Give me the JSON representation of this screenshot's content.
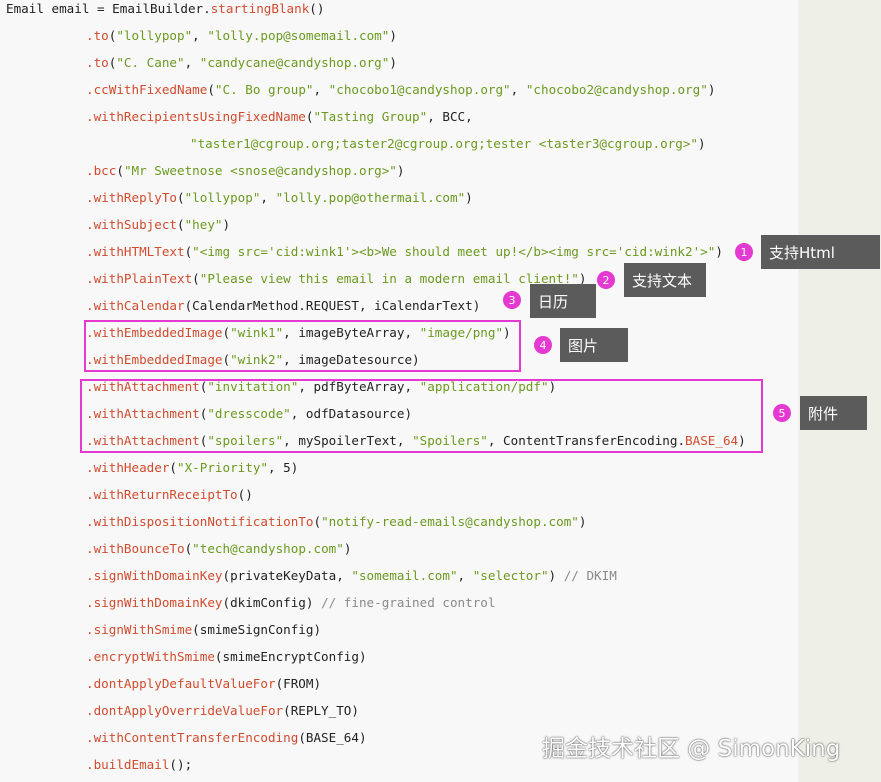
{
  "code": {
    "lines": [
      {
        "tokens": [
          [
            "plain",
            "Email email = EmailBuilder."
          ],
          [
            "fn",
            "startingBlank"
          ],
          [
            "plain",
            "()"
          ]
        ]
      },
      {
        "tokens": [
          [
            "fn",
            ".to"
          ],
          [
            "plain",
            "("
          ],
          [
            "str",
            "\"lollypop\""
          ],
          [
            "plain",
            ", "
          ],
          [
            "str",
            "\"lolly.pop@somemail.com\""
          ],
          [
            "plain",
            ")"
          ]
        ]
      },
      {
        "tokens": [
          [
            "fn",
            ".to"
          ],
          [
            "plain",
            "("
          ],
          [
            "str",
            "\"C. Cane\""
          ],
          [
            "plain",
            ", "
          ],
          [
            "str",
            "\"candycane@candyshop.org\""
          ],
          [
            "plain",
            ")"
          ]
        ]
      },
      {
        "tokens": [
          [
            "fn",
            ".ccWithFixedName"
          ],
          [
            "plain",
            "("
          ],
          [
            "str",
            "\"C. Bo group\""
          ],
          [
            "plain",
            ", "
          ],
          [
            "str",
            "\"chocobo1@candyshop.org\""
          ],
          [
            "plain",
            ", "
          ],
          [
            "str",
            "\"chocobo2@candyshop.org\""
          ],
          [
            "plain",
            ")"
          ]
        ]
      },
      {
        "tokens": [
          [
            "fn",
            ".withRecipientsUsingFixedName"
          ],
          [
            "plain",
            "("
          ],
          [
            "str",
            "\"Tasting Group\""
          ],
          [
            "plain",
            ", BCC,"
          ]
        ]
      },
      {
        "tokens": [
          [
            "str",
            "\"taster1@cgroup.org;taster2@cgroup.org;tester <taster3@cgroup.org>\""
          ],
          [
            "plain",
            ")"
          ]
        ]
      },
      {
        "tokens": [
          [
            "fn",
            ".bcc"
          ],
          [
            "plain",
            "("
          ],
          [
            "str",
            "\"Mr Sweetnose <snose@candyshop.org>\""
          ],
          [
            "plain",
            ")"
          ]
        ]
      },
      {
        "tokens": [
          [
            "fn",
            ".withReplyTo"
          ],
          [
            "plain",
            "("
          ],
          [
            "str",
            "\"lollypop\""
          ],
          [
            "plain",
            ", "
          ],
          [
            "str",
            "\"lolly.pop@othermail.com\""
          ],
          [
            "plain",
            ")"
          ]
        ]
      },
      {
        "tokens": [
          [
            "fn",
            ".withSubject"
          ],
          [
            "plain",
            "("
          ],
          [
            "str",
            "\"hey\""
          ],
          [
            "plain",
            ")"
          ]
        ]
      },
      {
        "tokens": [
          [
            "fn",
            ".withHTMLText"
          ],
          [
            "plain",
            "("
          ],
          [
            "str",
            "\"<img src='cid:wink1'><b>We should meet up!</b><img src='cid:wink2'>\""
          ],
          [
            "plain",
            ")"
          ]
        ]
      },
      {
        "tokens": [
          [
            "fn",
            ".withPlainText"
          ],
          [
            "plain",
            "("
          ],
          [
            "str",
            "\"Please view this email in a modern email client!\""
          ],
          [
            "plain",
            ")"
          ]
        ]
      },
      {
        "tokens": [
          [
            "fn",
            ".withCalendar"
          ],
          [
            "plain",
            "(CalendarMethod.REQUEST, iCalendarText)"
          ]
        ]
      },
      {
        "tokens": [
          [
            "fn",
            ".withEmbeddedImage"
          ],
          [
            "plain",
            "("
          ],
          [
            "str",
            "\"wink1\""
          ],
          [
            "plain",
            ", imageByteArray, "
          ],
          [
            "str",
            "\"image/png\""
          ],
          [
            "plain",
            ")"
          ]
        ]
      },
      {
        "tokens": [
          [
            "fn",
            ".withEmbeddedImage"
          ],
          [
            "plain",
            "("
          ],
          [
            "str",
            "\"wink2\""
          ],
          [
            "plain",
            ", imageDatesource)"
          ]
        ]
      },
      {
        "tokens": [
          [
            "fn",
            ".withAttachment"
          ],
          [
            "plain",
            "("
          ],
          [
            "str",
            "\"invitation\""
          ],
          [
            "plain",
            ", pdfByteArray, "
          ],
          [
            "str",
            "\"application/pdf\""
          ],
          [
            "plain",
            ")"
          ]
        ]
      },
      {
        "tokens": [
          [
            "fn",
            ".withAttachment"
          ],
          [
            "plain",
            "("
          ],
          [
            "str",
            "\"dresscode\""
          ],
          [
            "plain",
            ", odfDatasource)"
          ]
        ]
      },
      {
        "tokens": [
          [
            "fn",
            ".withAttachment"
          ],
          [
            "plain",
            "("
          ],
          [
            "str",
            "\"spoilers\""
          ],
          [
            "plain",
            ", mySpoilerText, "
          ],
          [
            "str",
            "\"Spoilers\""
          ],
          [
            "plain",
            ", ContentTransferEncoding."
          ],
          [
            "fn",
            "BASE_64"
          ],
          [
            "plain",
            ")"
          ]
        ]
      },
      {
        "tokens": [
          [
            "fn",
            ".withHeader"
          ],
          [
            "plain",
            "("
          ],
          [
            "str",
            "\"X-Priority\""
          ],
          [
            "plain",
            ", 5)"
          ]
        ]
      },
      {
        "tokens": [
          [
            "fn",
            ".withReturnReceiptTo"
          ],
          [
            "plain",
            "()"
          ]
        ]
      },
      {
        "tokens": [
          [
            "fn",
            ".withDispositionNotificationTo"
          ],
          [
            "plain",
            "("
          ],
          [
            "str",
            "\"notify-read-emails@candyshop.com\""
          ],
          [
            "plain",
            ")"
          ]
        ]
      },
      {
        "tokens": [
          [
            "fn",
            ".withBounceTo"
          ],
          [
            "plain",
            "("
          ],
          [
            "str",
            "\"tech@candyshop.com\""
          ],
          [
            "plain",
            ")"
          ]
        ]
      },
      {
        "tokens": [
          [
            "fn",
            ".signWithDomainKey"
          ],
          [
            "plain",
            "(privateKeyData, "
          ],
          [
            "str",
            "\"somemail.com\""
          ],
          [
            "plain",
            ", "
          ],
          [
            "str",
            "\"selector\""
          ],
          [
            "plain",
            ") "
          ],
          [
            "cmt",
            "// DKIM"
          ]
        ]
      },
      {
        "tokens": [
          [
            "fn",
            ".signWithDomainKey"
          ],
          [
            "plain",
            "(dkimConfig) "
          ],
          [
            "cmt",
            "// fine-grained control"
          ]
        ]
      },
      {
        "tokens": [
          [
            "fn",
            ".signWithSmime"
          ],
          [
            "plain",
            "(smimeSignConfig)"
          ]
        ]
      },
      {
        "tokens": [
          [
            "fn",
            ".encryptWithSmime"
          ],
          [
            "plain",
            "(smimeEncryptConfig)"
          ]
        ]
      },
      {
        "tokens": [
          [
            "fn",
            ".dontApplyDefaultValueFor"
          ],
          [
            "plain",
            "(FROM)"
          ]
        ]
      },
      {
        "tokens": [
          [
            "fn",
            ".dontApplyOverrideValueFor"
          ],
          [
            "plain",
            "(REPLY_TO)"
          ]
        ]
      },
      {
        "tokens": [
          [
            "fn",
            ".withContentTransferEncoding"
          ],
          [
            "plain",
            "(BASE_64)"
          ]
        ]
      },
      {
        "tokens": [
          [
            "fn",
            ".buildEmail"
          ],
          [
            "plain",
            "();"
          ]
        ]
      }
    ]
  },
  "annotations": [
    {
      "number": "1",
      "label": "支持Html"
    },
    {
      "number": "2",
      "label": "支持文本"
    },
    {
      "number": "3",
      "label": "日历"
    },
    {
      "number": "4",
      "label": "图片"
    },
    {
      "number": "5",
      "label": "附件"
    }
  ],
  "watermark": "掘金技术社区 @ SimonKing",
  "colors": {
    "method": "#d14b2e",
    "string": "#6b9a1f",
    "comment": "#8a8a8a",
    "highlight": "#e53ad1",
    "tag_bg": "#5b5b5b"
  }
}
